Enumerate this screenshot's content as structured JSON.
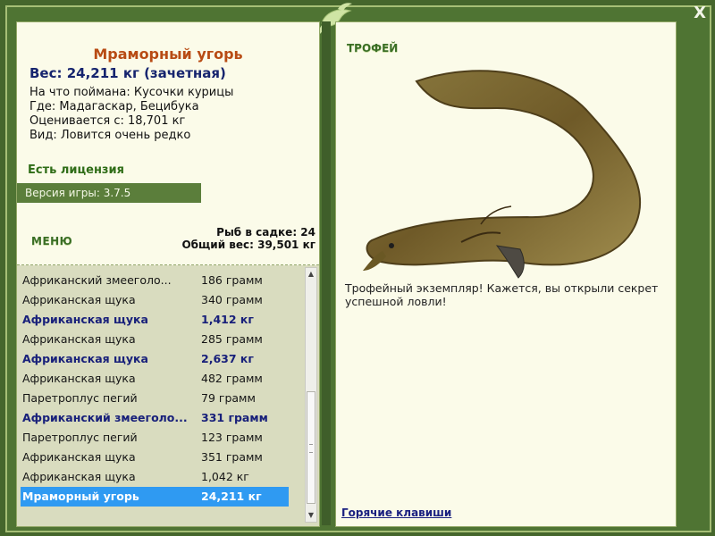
{
  "window": {
    "close_label": "X",
    "logo_icon": "fish-logo-icon"
  },
  "catch": {
    "title": "Мраморный угорь",
    "weight_line": "Вес: 24,211 кг (зачетная)",
    "bait_line": "На что поймана: Кусочки курицы",
    "location_line": "Где: Мадагаскар, Бецибука",
    "threshold_line": "Оценивается с: 18,701 кг",
    "rarity_line": "Вид: Ловится очень редко"
  },
  "license": {
    "label": "Есть лицензия"
  },
  "version": {
    "label": "Версия игры: 3.7.5"
  },
  "menu": {
    "label": "МЕНЮ"
  },
  "cage": {
    "count_line": "Рыб в садке: 24",
    "total_line": "Общий вес: 39,501 кг"
  },
  "fish_list": [
    {
      "name": "Африканский змееголо...",
      "weight": "186 грамм",
      "trophy": false,
      "selected": false
    },
    {
      "name": "Африканская щука",
      "weight": "340 грамм",
      "trophy": false,
      "selected": false
    },
    {
      "name": "Африканская щука",
      "weight": "1,412 кг",
      "trophy": true,
      "selected": false
    },
    {
      "name": "Африканская щука",
      "weight": "285 грамм",
      "trophy": false,
      "selected": false
    },
    {
      "name": "Африканская щука",
      "weight": "2,637 кг",
      "trophy": true,
      "selected": false
    },
    {
      "name": "Африканская щука",
      "weight": "482 грамм",
      "trophy": false,
      "selected": false
    },
    {
      "name": "Паретроплус пегий",
      "weight": "79 грамм",
      "trophy": false,
      "selected": false
    },
    {
      "name": "Африканский змееголо...",
      "weight": "331 грамм",
      "trophy": true,
      "selected": false
    },
    {
      "name": "Паретроплус пегий",
      "weight": "123 грамм",
      "trophy": false,
      "selected": false
    },
    {
      "name": "Африканская щука",
      "weight": "351 грамм",
      "trophy": false,
      "selected": false
    },
    {
      "name": "Африканская щука",
      "weight": "1,042 кг",
      "trophy": false,
      "selected": false
    },
    {
      "name": "Мраморный угорь",
      "weight": "24,211 кг",
      "trophy": false,
      "selected": true
    }
  ],
  "trophy": {
    "tab_label": "ТРОФЕЙ",
    "image_icon": "marbled-eel-image",
    "text": "Трофейный экземпляр! Кажется, вы открыли секрет успешной ловли!"
  },
  "hotkeys": {
    "label": "Горячие клавиши"
  },
  "colors": {
    "frame": "#45662c",
    "panel": "#fbfbe9",
    "list_bg": "#d9dcbf",
    "accent_title": "#b84b14",
    "trophy_text": "#18207a",
    "selection": "#2f9af2"
  }
}
